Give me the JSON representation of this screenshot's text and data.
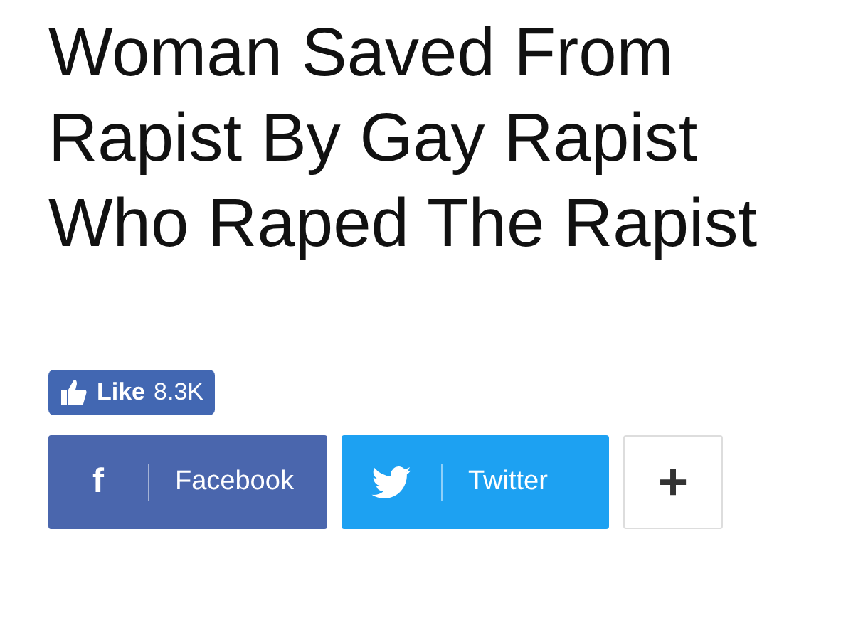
{
  "headline": "Woman Saved From Rapist By Gay Rapist Who Raped The Rapist",
  "like_button": {
    "label": "Like",
    "count": "8.3K"
  },
  "share_buttons": [
    {
      "kind": "facebook",
      "icon": "f",
      "label": "Facebook"
    },
    {
      "kind": "twitter",
      "label": "Twitter"
    },
    {
      "kind": "more",
      "icon": "+"
    }
  ]
}
